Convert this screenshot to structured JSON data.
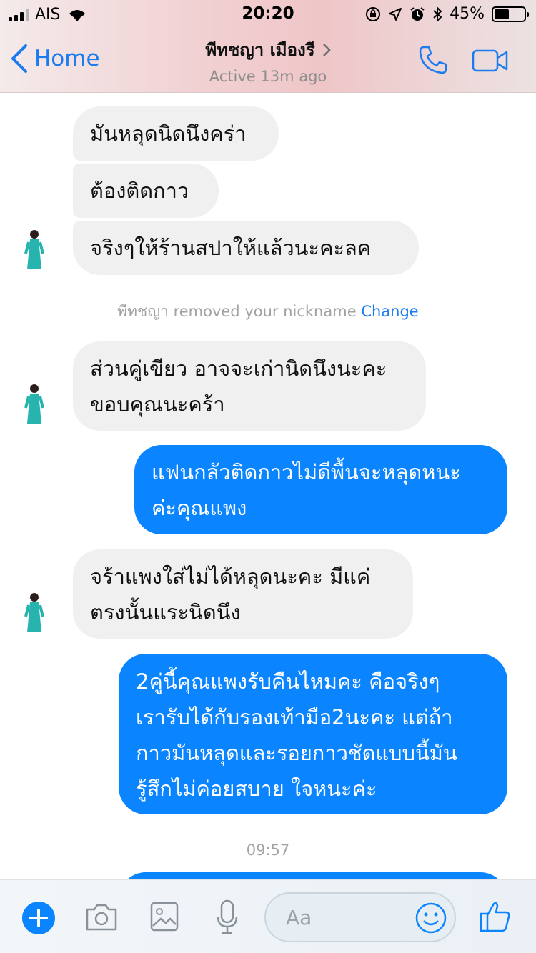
{
  "status_bar": {
    "carrier": "AIS",
    "time": "20:20",
    "battery": "45%",
    "icons": [
      "signal-icon",
      "wifi-icon",
      "orientation-lock-icon",
      "location-icon",
      "alarm-icon",
      "bluetooth-icon",
      "battery-icon"
    ]
  },
  "header": {
    "back_label": "Home",
    "contact_name": "พีทชญา เมืองรี",
    "status": "Active 13m ago",
    "icons": [
      "back-chevron-icon",
      "chevron-right-icon",
      "phone-icon",
      "video-camera-icon"
    ]
  },
  "messages": [
    {
      "from": "contact",
      "lines": [
        "มันหลุดนิดนึงคร่า"
      ]
    },
    {
      "from": "contact",
      "lines": [
        "ต้องติดกาว"
      ]
    },
    {
      "from": "contact",
      "lines": [
        "จริงๆให้ร้านสปาให้แล้วนะคะลค"
      ]
    },
    {
      "from": "system",
      "text": "พีทชญา removed your nickname",
      "link": "Change"
    },
    {
      "from": "contact",
      "lines": [
        "ส่วนคู่เขียว อาจจะเก่านิดนึงนะคะ",
        "ขอบคุณนะคร้า"
      ]
    },
    {
      "from": "me",
      "lines": [
        "แฟนกลัวติดกาวไม่ดีพื้นจะหลุดหนะ",
        "ค่ะคุณแพง"
      ]
    },
    {
      "from": "contact",
      "lines": [
        "จร้าแพงใส่ไม่ได้หลุดนะคะ มีแค่",
        "ตรงนั้นแระนิดนึง"
      ]
    },
    {
      "from": "me",
      "lines": [
        "2คู่นี้คุณแพงรับคืนไหมคะ คือจริงๆ",
        "เรารับได้กับรองเท้ามือ2นะคะ แต่ถ้า",
        "กาวมันหลุดและรอยกาวชัดแบบนี้มัน",
        "รู้สึกไม่ค่อยสบาย ใจหนะค่ะ"
      ]
    },
    {
      "from": "system",
      "text": "09:57"
    }
  ],
  "composer": {
    "placeholder": "Aa",
    "icons": [
      "add-icon",
      "camera-icon",
      "image-icon",
      "microphone-icon",
      "emoji-icon",
      "thumbs-up-icon"
    ]
  },
  "colors": {
    "accent": "#1a7cf0",
    "outgoing_bubble": "#0a84ff",
    "incoming_bubble": "#f0f0f0",
    "header_tint": "#f1cfd1"
  }
}
